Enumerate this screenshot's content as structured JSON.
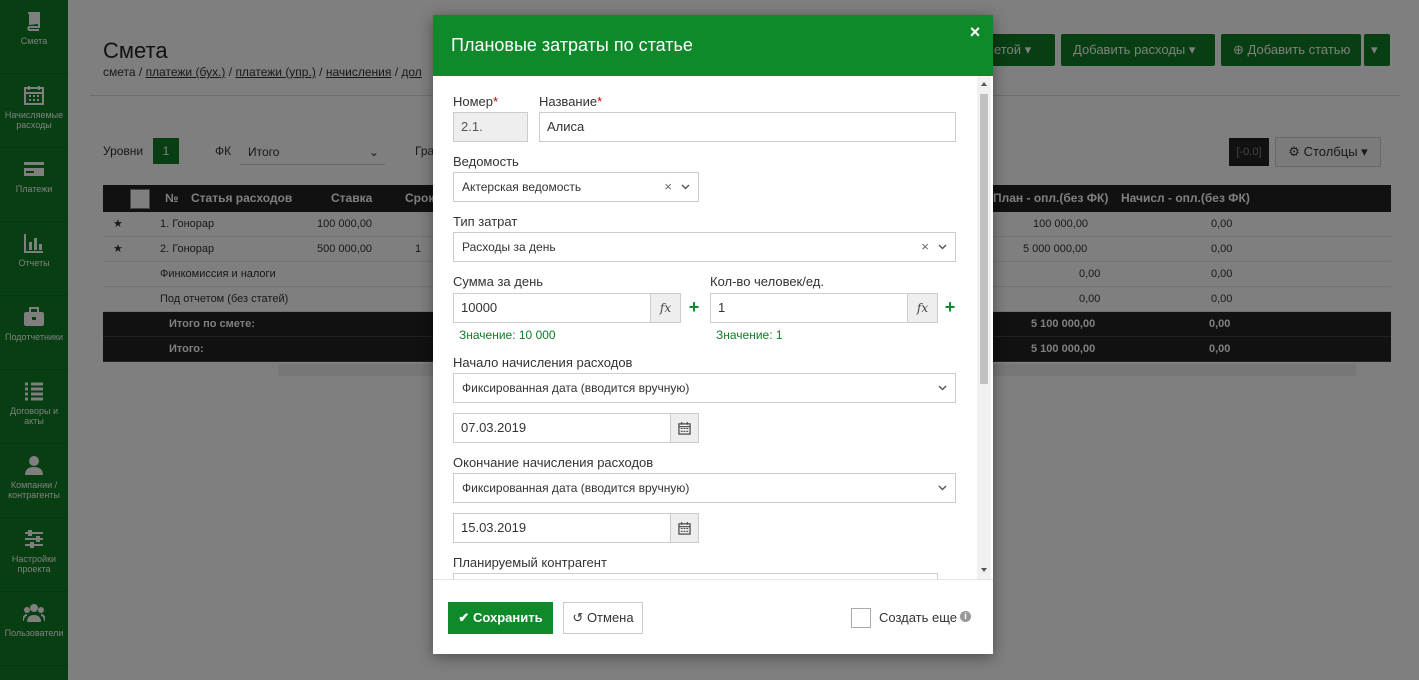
{
  "sidebar": {
    "items": [
      {
        "label": "Смета",
        "icon": "book-icon"
      },
      {
        "label": "Начисляемые расходы",
        "icon": "calendar-icon"
      },
      {
        "label": "Платежи",
        "icon": "card-icon"
      },
      {
        "label": "Отчеты",
        "icon": "bar-chart-icon"
      },
      {
        "label": "Подотчетники",
        "icon": "briefcase-icon"
      },
      {
        "label": "Договоры и акты",
        "icon": "list-icon"
      },
      {
        "label": "Компании / контрагенты",
        "icon": "user-icon"
      },
      {
        "label": "Настройки проекта",
        "icon": "sliders-icon"
      },
      {
        "label": "Пользователи",
        "icon": "users-icon"
      }
    ]
  },
  "page": {
    "title": "Смета",
    "breadcrumb_root": "смета",
    "breadcrumb_links": [
      "платежи (бух.)",
      "платежи (упр.)",
      "начисления",
      "дол"
    ],
    "sep": "/",
    "buttons": {
      "smeta_partial": "метой",
      "add_expenses": "Добавить расходы",
      "add_article": "Добавить статью"
    },
    "filters": {
      "levels_label": "Уровни",
      "levels_value": "1",
      "fk_label": "ФК",
      "fk_value": "Итого",
      "gr_label": "Гра",
      "zoom": "[-0.0]",
      "columns_button": "Столбцы"
    },
    "table": {
      "headers": [
        "№",
        "Статья расходов",
        "Ставка",
        "Срок",
        "План - опл.(без ФК)",
        "Начисл - опл.(без ФК)"
      ],
      "rows": [
        {
          "name": "1. Гонорар",
          "rate": "100 000,00",
          "term": "",
          "plan": "100 000,00",
          "accrued": "0,00",
          "star": true
        },
        {
          "name": "2. Гонорар",
          "rate": "500 000,00",
          "term": "1",
          "plan": "5 000 000,00",
          "accrued": "0,00",
          "star": true
        },
        {
          "name": "Финкомиссия и налоги",
          "rate": "",
          "term": "",
          "plan": "0,00",
          "accrued": "0,00",
          "star": false
        },
        {
          "name": "Под отчетом (без статей)",
          "rate": "",
          "term": "",
          "plan": "0,00",
          "accrued": "0,00",
          "star": false
        }
      ],
      "totals": [
        {
          "name": "Итого по смете:",
          "plan": "5 100 000,00",
          "accrued": "0,00"
        },
        {
          "name": "Итого:",
          "plan": "5 100 000,00",
          "accrued": "0,00"
        }
      ]
    }
  },
  "modal": {
    "title": "Плановые затраты по статье",
    "close": "×",
    "fields": {
      "number_label": "Номер",
      "number_value": "2.1.",
      "name_label": "Название",
      "name_value": "Алиса",
      "required_mark": "*",
      "sheet_label": "Ведомость",
      "sheet_value": "Актерская ведомость",
      "cost_type_label": "Тип затрат",
      "cost_type_value": "Расходы за день",
      "amount_label": "Сумма за день",
      "amount_value": "10000",
      "amount_hint": "Значение: 10 000",
      "qty_label": "Кол-во человек/ед.",
      "qty_value": "1",
      "qty_hint": "Значение: 1",
      "fx": "fx",
      "start_label": "Начало начисления расходов",
      "start_mode": "Фиксированная дата (вводится вручную)",
      "start_date": "07.03.2019",
      "end_label": "Окончание начисления расходов",
      "end_mode": "Фиксированная дата (вводится вручную)",
      "end_date": "15.03.2019",
      "contractor_label": "Планируемый контрагент"
    },
    "footer": {
      "save": "Сохранить",
      "cancel": "Отмена",
      "create_more": "Создать еще",
      "info": "i"
    }
  },
  "colors": {
    "brand_green": "#0f7d24",
    "header_green": "#0f8a2b",
    "hint_green": "#0f7d24",
    "dark_row": "#222222"
  }
}
